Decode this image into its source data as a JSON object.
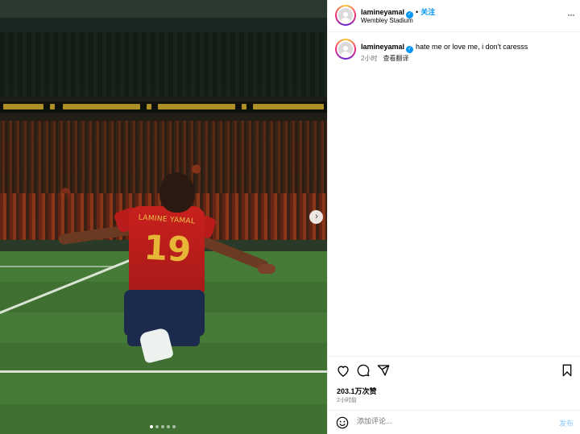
{
  "post": {
    "media_alt_icons": {
      "next": "chevron-right-icon"
    },
    "jersey": {
      "name": "LAMINE YAMAL",
      "number": "19"
    },
    "carousel": {
      "total": 5,
      "active_index": 0
    }
  },
  "header": {
    "username": "lamineyamal",
    "separator": "•",
    "follow_label": "关注",
    "location": "Wembley Stadium",
    "more": "···"
  },
  "caption": {
    "username": "lamineyamal",
    "text": "hate me or love me, i don't caresss",
    "time": "2小时",
    "see_translation": "查看翻译"
  },
  "actions": {
    "likes": "203.1万次赞",
    "time": "2小时前"
  },
  "comment": {
    "placeholder": "添加评论...",
    "post_label": "发布"
  },
  "colors": {
    "accent": "#0095f6",
    "post_disabled": "#89c8fb",
    "muted_text": "#737373"
  }
}
